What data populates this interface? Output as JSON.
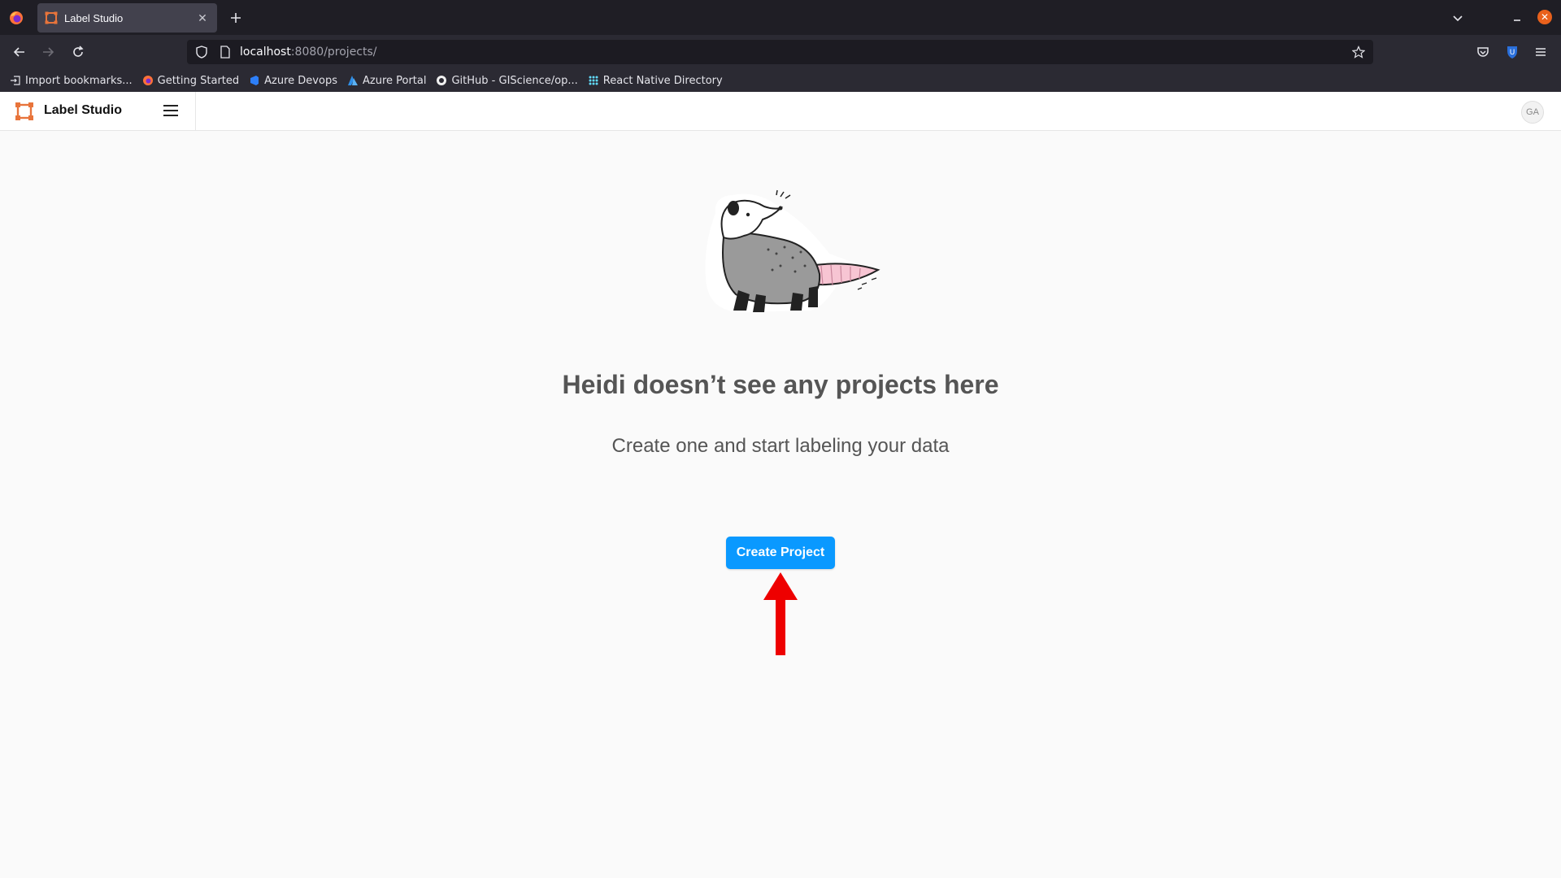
{
  "browser": {
    "tab_title": "Label Studio",
    "url_host": "localhost",
    "url_rest": ":8080/projects/",
    "bookmarks": [
      {
        "label": "Import bookmarks...",
        "icon": "import-icon"
      },
      {
        "label": "Getting Started",
        "icon": "firefox-icon"
      },
      {
        "label": "Azure Devops",
        "icon": "azure-devops-icon"
      },
      {
        "label": "Azure Portal",
        "icon": "azure-icon"
      },
      {
        "label": "GitHub - GIScience/op...",
        "icon": "github-icon"
      },
      {
        "label": "React Native Directory",
        "icon": "react-icon"
      }
    ]
  },
  "app": {
    "name": "Label Studio",
    "avatar_initials": "GA"
  },
  "empty_state": {
    "title": "Heidi doesn’t see any projects here",
    "subtitle": "Create one and start labeling your data",
    "button_label": "Create Project"
  },
  "colors": {
    "accent": "#0a99ff",
    "arrow": "#ee0000",
    "logo": "#e8743b"
  }
}
